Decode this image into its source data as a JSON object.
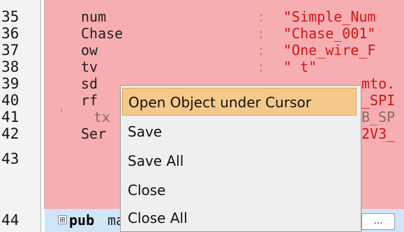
{
  "editor": {
    "lines": [
      {
        "no": "35",
        "name": "num",
        "value": "\"Simple_Num",
        "dim": false
      },
      {
        "no": "36",
        "name": "Chase",
        "value": "\"Chase_001\"",
        "dim": false
      },
      {
        "no": "37",
        "name": "ow",
        "value": "\"One_wire_F",
        "dim": false
      },
      {
        "no": "38",
        "name": "tv",
        "value": "\"   t\"",
        "dim": false
      },
      {
        "no": "39",
        "name": "sd",
        "value": "mto.",
        "dim": false
      },
      {
        "no": "40",
        "name": "rf",
        "value": "_SPI",
        "dim": false
      },
      {
        "no": "41",
        "name": "tx",
        "value": "B_SP",
        "dim": true
      },
      {
        "no": "42",
        "name": "Ser",
        "value": "2V3_",
        "dim": false
      }
    ],
    "colon": ":",
    "line43_no": "43",
    "line44": {
      "no": "44",
      "fold_symbol": "⊞",
      "keyword": "pub",
      "rest": "ma",
      "ellipsis": "..."
    }
  },
  "context_menu": {
    "items": [
      {
        "label": "Open Object under Cursor",
        "selected": true
      },
      {
        "label": "Save",
        "selected": false
      },
      {
        "label": "Save All",
        "selected": false
      },
      {
        "label": "Close",
        "selected": false
      },
      {
        "label": "Close All",
        "selected": false
      }
    ]
  },
  "colors": {
    "code_background": "#f6aeb2",
    "string_value": "#d11515",
    "menu_highlight": "#f5c98b",
    "status_line": "#cfe5f8"
  }
}
